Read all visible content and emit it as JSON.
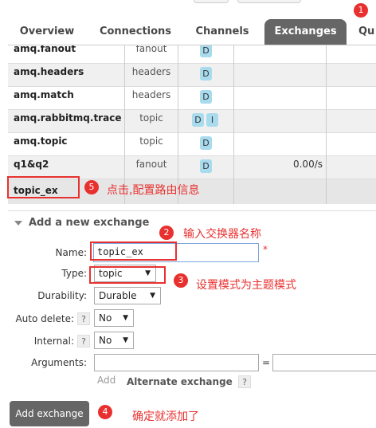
{
  "tabs": [
    "Overview",
    "Connections",
    "Channels",
    "Exchanges",
    "Qu"
  ],
  "active_tab": "Exchanges",
  "exchanges": [
    {
      "name": "amq.fanout",
      "type": "fanout",
      "features": [
        "D"
      ],
      "rate": ""
    },
    {
      "name": "amq.headers",
      "type": "headers",
      "features": [
        "D"
      ],
      "rate": ""
    },
    {
      "name": "amq.match",
      "type": "headers",
      "features": [
        "D"
      ],
      "rate": ""
    },
    {
      "name": "amq.rabbitmq.trace",
      "type": "topic",
      "features": [
        "D",
        "I"
      ],
      "rate": ""
    },
    {
      "name": "amq.topic",
      "type": "topic",
      "features": [
        "D"
      ],
      "rate": ""
    },
    {
      "name": "q1&q2",
      "type": "fanout",
      "features": [
        "D"
      ],
      "rate": "0.00/s"
    },
    {
      "name": "topic_ex",
      "type": "",
      "features": [],
      "rate": ""
    }
  ],
  "add_section": {
    "title": "Add a new exchange",
    "name_label": "Name:",
    "name_value": "topic_ex",
    "required_mark": "*",
    "type_label": "Type:",
    "type_value": "topic",
    "durability_label": "Durability:",
    "durability_value": "Durable",
    "auto_delete_label": "Auto delete:",
    "auto_delete_value": "No",
    "internal_label": "Internal:",
    "internal_value": "No",
    "arguments_label": "Arguments:",
    "arguments_eq": "=",
    "add_link": "Add",
    "alternate_exchange": "Alternate exchange",
    "help": "?",
    "submit_label": "Add exchange"
  },
  "annotations": {
    "n1": "1",
    "n2": "2",
    "t2": "输入交换器名称",
    "n3": "3",
    "t3": "设置模式为主题模式",
    "n4": "4",
    "t4": "确定就添加了",
    "n5": "5",
    "t5": "点击,配置路由信息"
  },
  "colors": {
    "accent_red": "#e8312f",
    "tab_active": "#666666",
    "badge": "#a8dbed",
    "name_input_border": "#7ba7e0"
  }
}
